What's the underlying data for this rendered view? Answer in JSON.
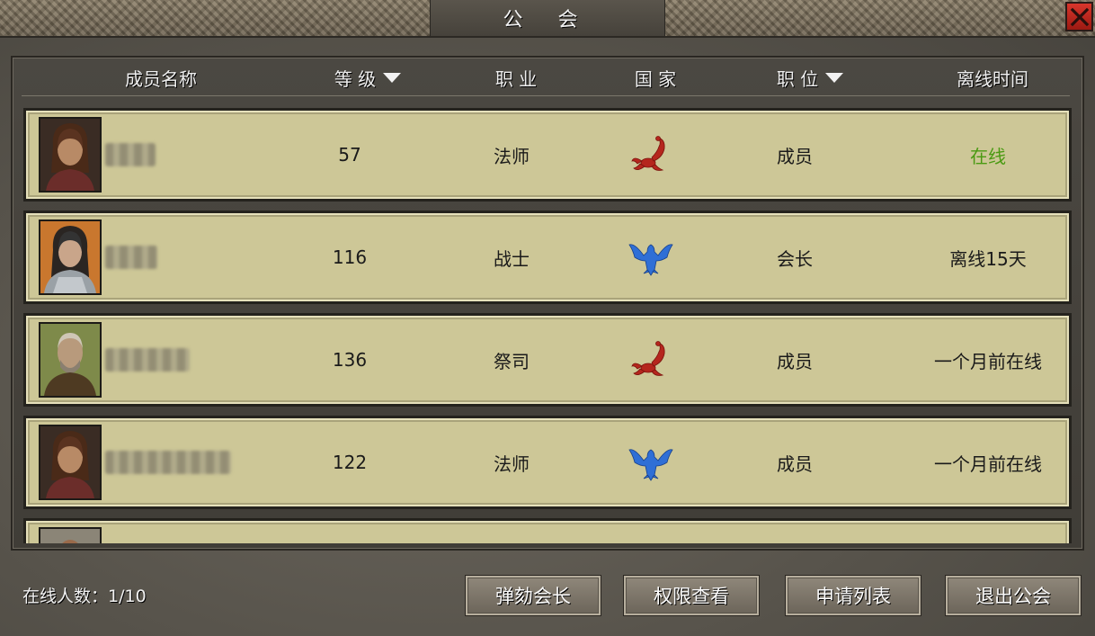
{
  "window": {
    "title": "公 会"
  },
  "columns": {
    "name": "成员名称",
    "level": "等 级",
    "job": "职 业",
    "nation": "国 家",
    "position": "职 位",
    "offline": "离线时间"
  },
  "members": [
    {
      "level": "57",
      "job": "法师",
      "nation_icon": "scorpion-emblem-icon",
      "position": "成员",
      "status": "在线",
      "status_color": "#4a9a12",
      "avatar": "mage-portrait"
    },
    {
      "level": "116",
      "job": "战士",
      "nation_icon": "eagle-emblem-icon",
      "position": "会长",
      "status": "离线15天",
      "status_color": "#1a1a1a",
      "avatar": "warrior-portrait"
    },
    {
      "level": "136",
      "job": "祭司",
      "nation_icon": "scorpion-emblem-icon",
      "position": "成员",
      "status": "一个月前在线",
      "status_color": "#1a1a1a",
      "avatar": "priest-portrait"
    },
    {
      "level": "122",
      "job": "法师",
      "nation_icon": "eagle-emblem-icon",
      "position": "成员",
      "status": "一个月前在线",
      "status_color": "#1a1a1a",
      "avatar": "mage-portrait"
    }
  ],
  "footer": {
    "online_count": "在线人数：1/10",
    "impeach_label": "弹劾会长",
    "permissions_label": "权限查看",
    "applications_label": "申请列表",
    "leave_label": "退出公会"
  },
  "colors": {
    "row_bg": "#cdc797",
    "online_green": "#4a9a12",
    "scorpion_red": "#b5261d",
    "eagle_blue": "#2f6fd6",
    "close_red": "#c42a20"
  }
}
